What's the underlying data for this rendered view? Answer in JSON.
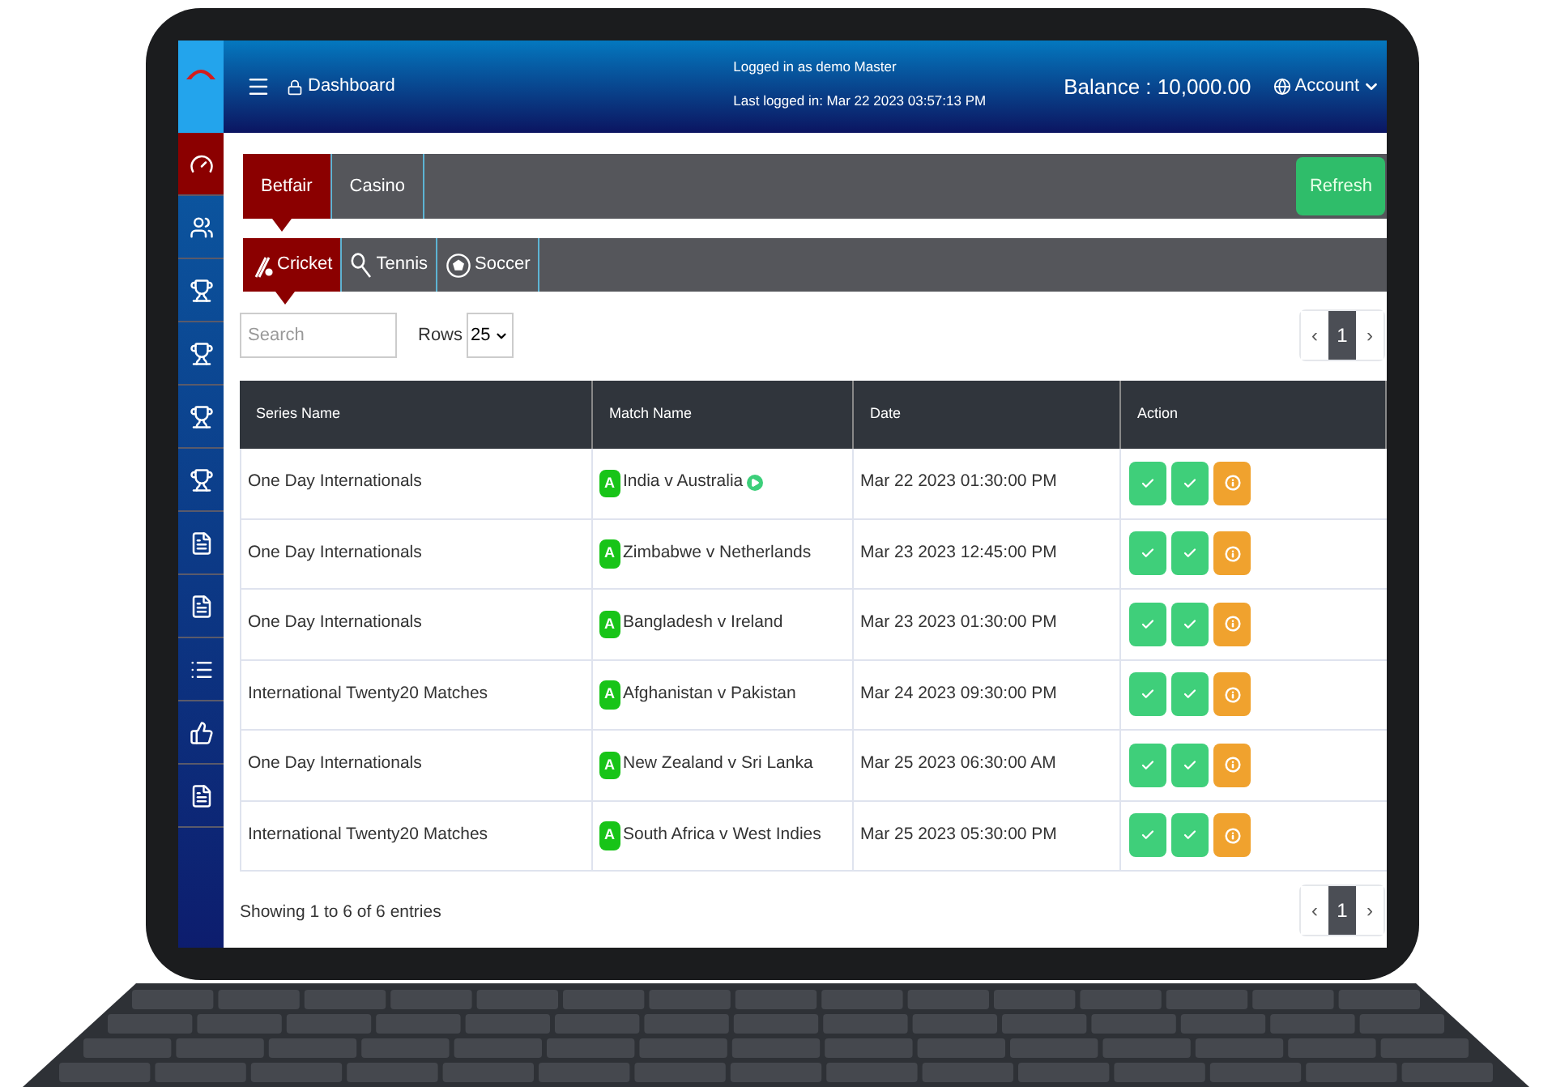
{
  "header": {
    "title": "Dashboard",
    "login_line": "Logged in as demo Master",
    "last_login": "Last logged in: Mar 22 2023 03:57:13 PM",
    "balance": "Balance : 10,000.00",
    "account": "Account"
  },
  "sidebar": {
    "items": [
      {
        "kind": "dashboard",
        "selected": true
      },
      {
        "kind": "users",
        "selected": false
      },
      {
        "kind": "trophy",
        "selected": false
      },
      {
        "kind": "trophy",
        "selected": false
      },
      {
        "kind": "trophy",
        "selected": false
      },
      {
        "kind": "trophy",
        "selected": false
      },
      {
        "kind": "document",
        "selected": false
      },
      {
        "kind": "document",
        "selected": false
      },
      {
        "kind": "list",
        "selected": false
      },
      {
        "kind": "thumbs-up",
        "selected": false
      },
      {
        "kind": "document",
        "selected": false
      }
    ]
  },
  "provider_tabs": [
    {
      "label": "Betfair",
      "selected": true
    },
    {
      "label": "Casino",
      "selected": false
    }
  ],
  "refresh_button": "Refresh",
  "sport_tabs": [
    {
      "label": "Cricket",
      "kind": "cricket",
      "selected": true
    },
    {
      "label": "Tennis",
      "kind": "tennis",
      "selected": false
    },
    {
      "label": "Soccer",
      "kind": "soccer",
      "selected": false
    }
  ],
  "search": {
    "placeholder": "Search"
  },
  "rows_select": {
    "label": "Rows",
    "value": "25"
  },
  "pagination": [
    {
      "label": "‹",
      "selected": false
    },
    {
      "label": "1",
      "selected": true
    },
    {
      "label": "›",
      "selected": false
    }
  ],
  "table": {
    "columns": [
      "Series Name",
      "Match Name",
      "Date",
      "Action"
    ],
    "action_buttons": [
      {
        "kind": "check"
      },
      {
        "kind": "check"
      },
      {
        "kind": "info"
      }
    ],
    "rows": [
      {
        "series": "One Day Internationals",
        "badge": "A",
        "match": "India v Australia",
        "live": true,
        "date": "Mar 22 2023 01:30:00 PM"
      },
      {
        "series": "One Day Internationals",
        "badge": "A",
        "match": "Zimbabwe v Netherlands",
        "live": false,
        "date": "Mar 23 2023 12:45:00 PM"
      },
      {
        "series": "One Day Internationals",
        "badge": "A",
        "match": "Bangladesh v Ireland",
        "live": false,
        "date": "Mar 23 2023 01:30:00 PM"
      },
      {
        "series": "International Twenty20 Matches",
        "badge": "A",
        "match": "Afghanistan v Pakistan",
        "live": false,
        "date": "Mar 24 2023 09:30:00 PM"
      },
      {
        "series": "One Day Internationals",
        "badge": "A",
        "match": "New Zealand v Sri Lanka",
        "live": false,
        "date": "Mar 25 2023 06:30:00 AM"
      },
      {
        "series": "International Twenty20 Matches",
        "badge": "A",
        "match": "South Africa v West Indies",
        "live": false,
        "date": "Mar 25 2023 05:30:00 PM"
      }
    ]
  },
  "footer": {
    "entries": "Showing 1 to 6 of 6 entries",
    "pagination": [
      {
        "label": "‹",
        "selected": false
      },
      {
        "label": "1",
        "selected": true
      },
      {
        "label": "›",
        "selected": false
      }
    ]
  }
}
